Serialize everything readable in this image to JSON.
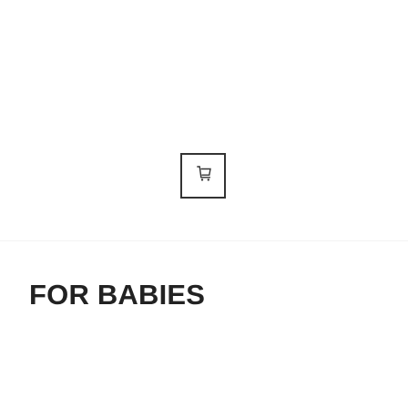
{
  "header": {
    "menu_icon": "hamburger-menu-icon",
    "cart_icon": "shopping-cart-icon"
  },
  "section": {
    "title": "FOR BABIES"
  },
  "colors": {
    "text": "#222222",
    "border": "#333333",
    "background": "#ffffff",
    "divider": "#f3f3f3"
  }
}
